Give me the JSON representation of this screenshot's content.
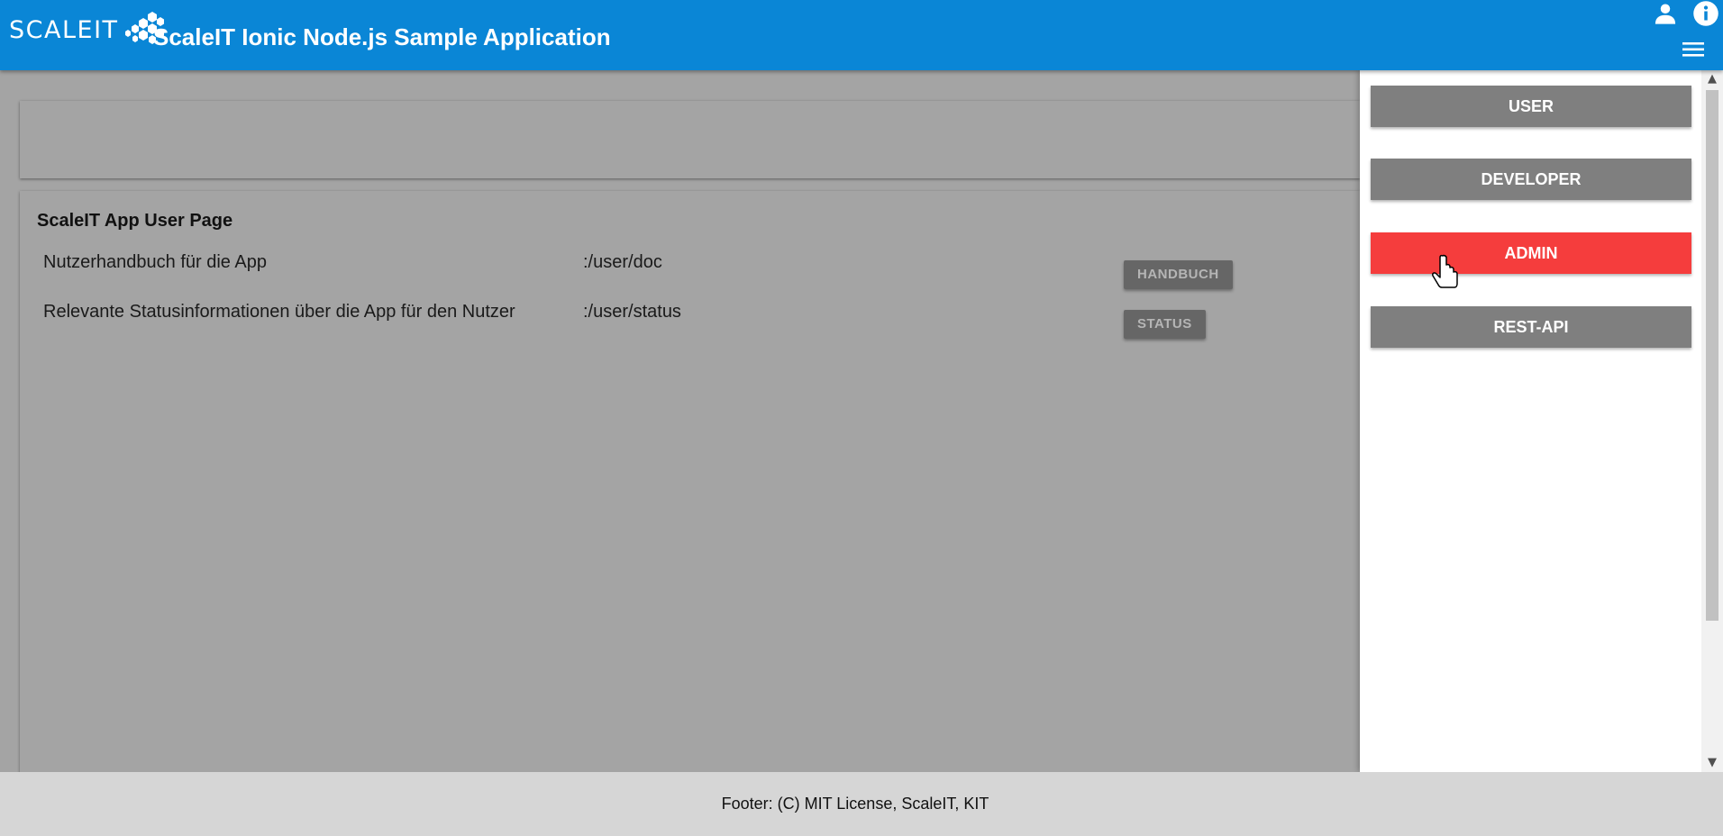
{
  "header": {
    "logo_text": "SCALEIT",
    "title": "ScaleIT Ionic Node.js Sample Application",
    "icons": [
      "user-icon",
      "info-icon",
      "menu-icon"
    ],
    "color": "#0a86d6"
  },
  "main": {
    "page_title": "ScaleIT App User Page",
    "rows": [
      {
        "description": "Nutzerhandbuch für die App",
        "path": ":/user/doc",
        "button": "HANDBUCH"
      },
      {
        "description": "Relevante Statusinformationen über die App für den Nutzer",
        "path": ":/user/status",
        "button": "STATUS"
      }
    ]
  },
  "side_menu": {
    "items": [
      {
        "label": "USER",
        "color": "#7f7f7f"
      },
      {
        "label": "DEVELOPER",
        "color": "#7f7f7f"
      },
      {
        "label": "ADMIN",
        "color": "#f53d3d"
      },
      {
        "label": "REST-API",
        "color": "#7f7f7f"
      }
    ],
    "scroll_up": "▲",
    "scroll_down": "▼"
  },
  "footer": {
    "text": "Footer: (C) MIT License, ScaleIT, KIT"
  }
}
